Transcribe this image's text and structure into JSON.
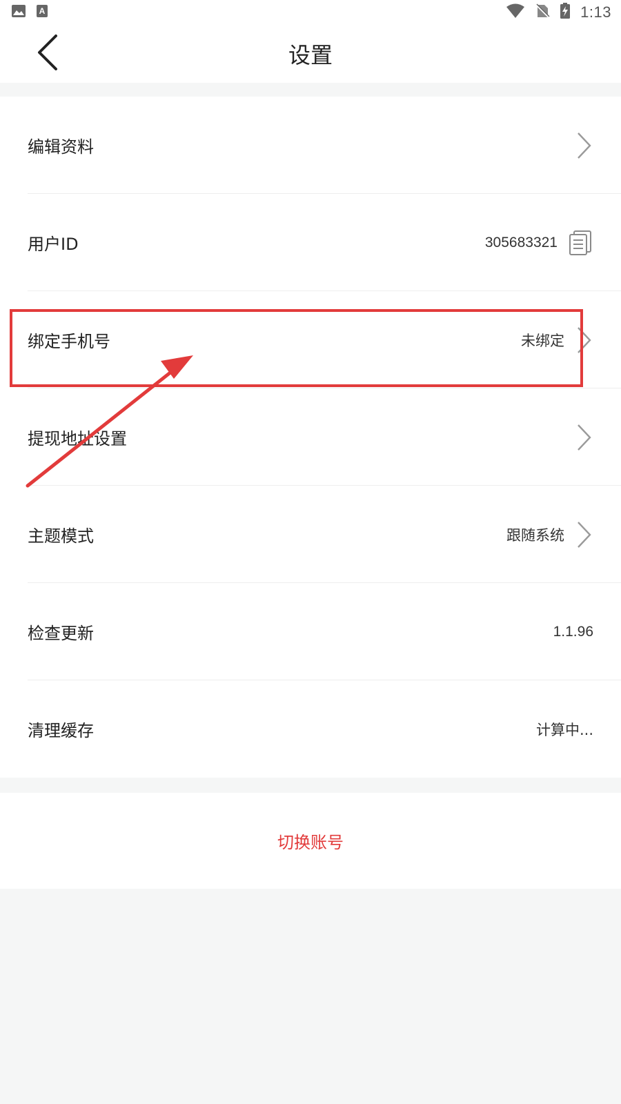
{
  "status_bar": {
    "time": "1:13",
    "left_icons": [
      "image-icon",
      "text-a-icon"
    ],
    "right_icons": [
      "wifi-icon",
      "no-sim-icon",
      "battery-charging-icon"
    ]
  },
  "header": {
    "title": "设置",
    "back_icon": "chevron-left-icon"
  },
  "settings": {
    "rows": [
      {
        "label": "编辑资料",
        "value": "",
        "trailing": "chevron-right-icon"
      },
      {
        "label": "用户ID",
        "value": "305683321",
        "trailing": "copy-icon"
      },
      {
        "label": "绑定手机号",
        "value": "未绑定",
        "trailing": "chevron-right-icon"
      },
      {
        "label": "提现地址设置",
        "value": "",
        "trailing": "chevron-right-icon"
      },
      {
        "label": "主题模式",
        "value": "跟随系统",
        "trailing": "chevron-right-icon"
      },
      {
        "label": "检查更新",
        "value": "1.1.96",
        "trailing": ""
      },
      {
        "label": "清理缓存",
        "value": "计算中...",
        "trailing": ""
      }
    ]
  },
  "switch_account": {
    "label": "切换账号"
  },
  "colors": {
    "accent_red": "#e23b3b",
    "background": "#f5f6f6",
    "card": "#ffffff",
    "chevron": "#9a9a9a"
  },
  "annotation": {
    "highlighted_row": "绑定手机号",
    "arrow_icon": "red-arrow-annotation"
  }
}
